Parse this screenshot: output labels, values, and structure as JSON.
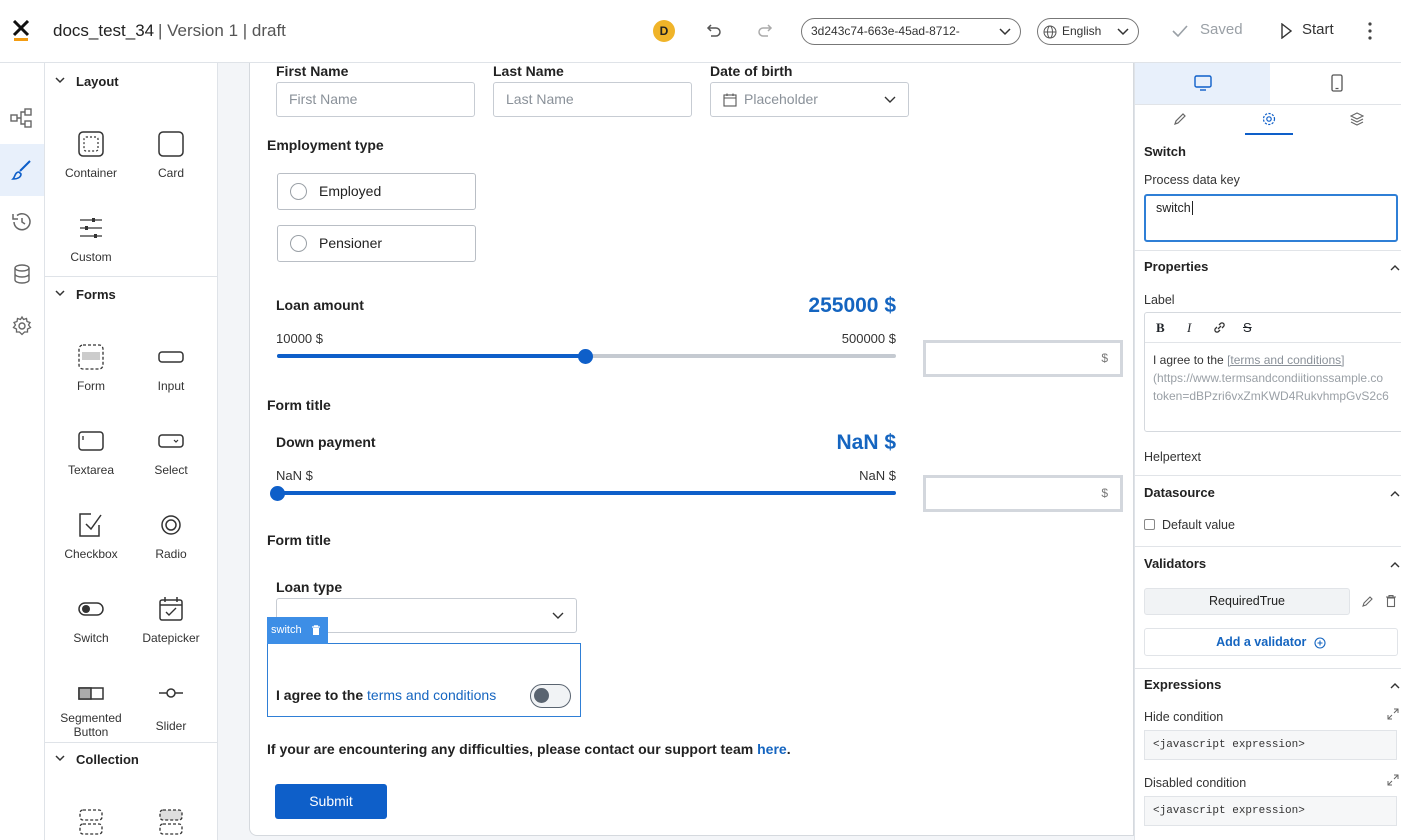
{
  "header": {
    "doc_name": "docs_test_34",
    "version_text": "| Version 1 | draft",
    "avatar_initial": "D",
    "process_id": "3d243c74-663e-45ad-8712-",
    "language": "English",
    "saved_label": "Saved",
    "start_label": "Start"
  },
  "palette": {
    "sections": {
      "layout": "Layout",
      "forms": "Forms",
      "collection": "Collection"
    },
    "layout_items": {
      "container": "Container",
      "card": "Card",
      "custom": "Custom"
    },
    "form_items": {
      "form": "Form",
      "input": "Input",
      "textarea": "Textarea",
      "select": "Select",
      "checkbox": "Checkbox",
      "radio": "Radio",
      "switch": "Switch",
      "datepicker": "Datepicker",
      "segmented_line1": "Segmented",
      "segmented_line2": "Button",
      "slider": "Slider"
    }
  },
  "form": {
    "first_name_label": "First Name",
    "first_name_placeholder": "First Name",
    "last_name_label": "Last Name",
    "last_name_placeholder": "Last Name",
    "dob_label": "Date of birth",
    "dob_placeholder": "Placeholder",
    "employment_label": "Employment type",
    "employment_options": [
      "Employed",
      "Pensioner"
    ],
    "loan_amount_label": "Loan amount",
    "loan_amount_value": "255000 $",
    "loan_amount_min": "10000 $",
    "loan_amount_max": "500000 $",
    "loan_amount_fraction": 0.497,
    "currency_suffix": "$",
    "form_title_1": "Form title",
    "down_payment_label": "Down payment",
    "down_payment_value": "NaN $",
    "down_payment_min": "NaN $",
    "down_payment_max": "NaN $",
    "down_payment_fraction": 0.0,
    "form_title_2": "Form title",
    "loan_type_label": "Loan type",
    "switch_tag": "switch",
    "agree_text": "I agree to the ",
    "terms_link": "terms and conditions",
    "switch_on": false,
    "support_text": "If your are encountering any difficulties, please contact our support team ",
    "support_link": "here",
    "support_end": ".",
    "submit_label": "Submit"
  },
  "panel": {
    "component_title": "Switch",
    "key_label": "Process data key",
    "key_value": "switch",
    "properties_title": "Properties",
    "label_title": "Label",
    "label_line1_prefix": "I agree to the ",
    "label_line1_link": "[terms and conditions]",
    "label_line2": "(https://www.termsandcondiitionssample.co",
    "label_line3": "token=dBPzri6vxZmKWD4RukvhmpGvS2c6",
    "helpertext_title": "Helpertext",
    "datasource_title": "Datasource",
    "default_value_label": "Default value",
    "validators_title": "Validators",
    "validator_name": "RequiredTrue",
    "add_validator": "Add a validator",
    "expressions_title": "Expressions",
    "hide_label": "Hide condition",
    "hide_value": "<javascript expression>",
    "disabled_label": "Disabled condition",
    "disabled_value": "<javascript expression>"
  },
  "colors": {
    "accent": "#0e5fc9",
    "link": "#1565c0",
    "avatar": "#f0b429"
  }
}
